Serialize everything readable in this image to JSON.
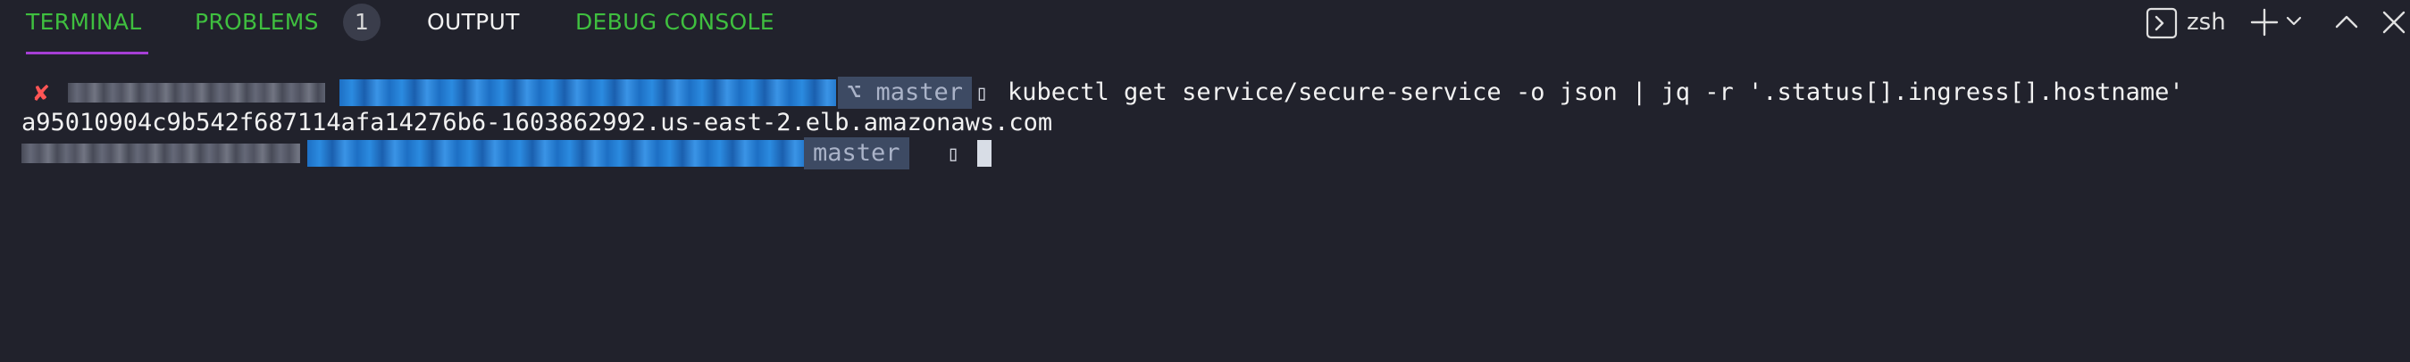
{
  "panel": {
    "tabs": [
      {
        "label": "TERMINAL",
        "active": true
      },
      {
        "label": "PROBLEMS",
        "badge": "1"
      },
      {
        "label": "OUTPUT"
      },
      {
        "label": "DEBUG CONSOLE"
      }
    ],
    "shell_name": "zsh",
    "active_color": "#3fbf3f",
    "underline_color": "#a63fd6"
  },
  "terminal": {
    "prompt1": {
      "status_icon": "x-mark-icon",
      "status_symbol": "✘",
      "branch": "master",
      "command": "kubectl get service/secure-service -o json | jq -r '.status[].ingress[].hostname'"
    },
    "output_line": "a95010904c9b542f687114afa14276b6-1603862992.us-east-2.elb.amazonaws.com",
    "prompt2": {
      "branch": "master"
    }
  }
}
